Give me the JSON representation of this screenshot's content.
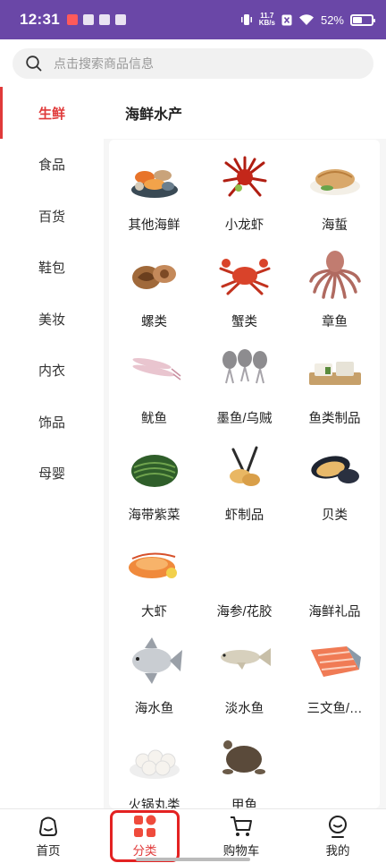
{
  "status_bar": {
    "time": "12:31",
    "speed_value": "11.7",
    "speed_unit": "KB/s",
    "battery": "52%",
    "battery_level": 0.52
  },
  "search": {
    "placeholder": "点击搜索商品信息"
  },
  "sidebar": {
    "items": [
      {
        "label": "生鲜",
        "active": true
      },
      {
        "label": "食品"
      },
      {
        "label": "百货"
      },
      {
        "label": "鞋包"
      },
      {
        "label": "美妆"
      },
      {
        "label": "内衣"
      },
      {
        "label": "饰品"
      },
      {
        "label": "母婴"
      }
    ]
  },
  "category": {
    "title": "海鲜水产"
  },
  "products": [
    {
      "label": "其他海鲜",
      "icon": "mixed-seafood-icon"
    },
    {
      "label": "小龙虾",
      "icon": "crayfish-icon"
    },
    {
      "label": "海蜇",
      "icon": "jellyfish-icon"
    },
    {
      "label": "螺类",
      "icon": "snail-icon"
    },
    {
      "label": "蟹类",
      "icon": "crab-icon"
    },
    {
      "label": "章鱼",
      "icon": "octopus-icon"
    },
    {
      "label": "鱿鱼",
      "icon": "squid-icon"
    },
    {
      "label": "墨鱼/乌贼",
      "icon": "cuttlefish-icon"
    },
    {
      "label": "鱼类制品",
      "icon": "fish-product-icon"
    },
    {
      "label": "海带紫菜",
      "icon": "seaweed-icon"
    },
    {
      "label": "虾制品",
      "icon": "shrimp-product-icon"
    },
    {
      "label": "贝类",
      "icon": "mussel-icon"
    },
    {
      "label": "大虾",
      "icon": "prawn-icon"
    },
    {
      "label": "海参/花胶",
      "icon": ""
    },
    {
      "label": "海鲜礼品",
      "icon": ""
    },
    {
      "label": "海水鱼",
      "icon": "pomfret-icon"
    },
    {
      "label": "淡水鱼",
      "icon": "carp-icon"
    },
    {
      "label": "三文鱼/…",
      "icon": "salmon-icon"
    },
    {
      "label": "火锅丸类",
      "icon": "fishball-icon"
    },
    {
      "label": "甲鱼",
      "icon": "turtle-icon"
    }
  ],
  "bottom_nav": [
    {
      "label": "首页",
      "icon": "home-icon"
    },
    {
      "label": "分类",
      "icon": "category-icon",
      "active": true
    },
    {
      "label": "购物车",
      "icon": "cart-icon"
    },
    {
      "label": "我的",
      "icon": "profile-icon"
    }
  ],
  "colors": {
    "status_bar": "#6a47a7",
    "accent": "#e03a3a"
  }
}
